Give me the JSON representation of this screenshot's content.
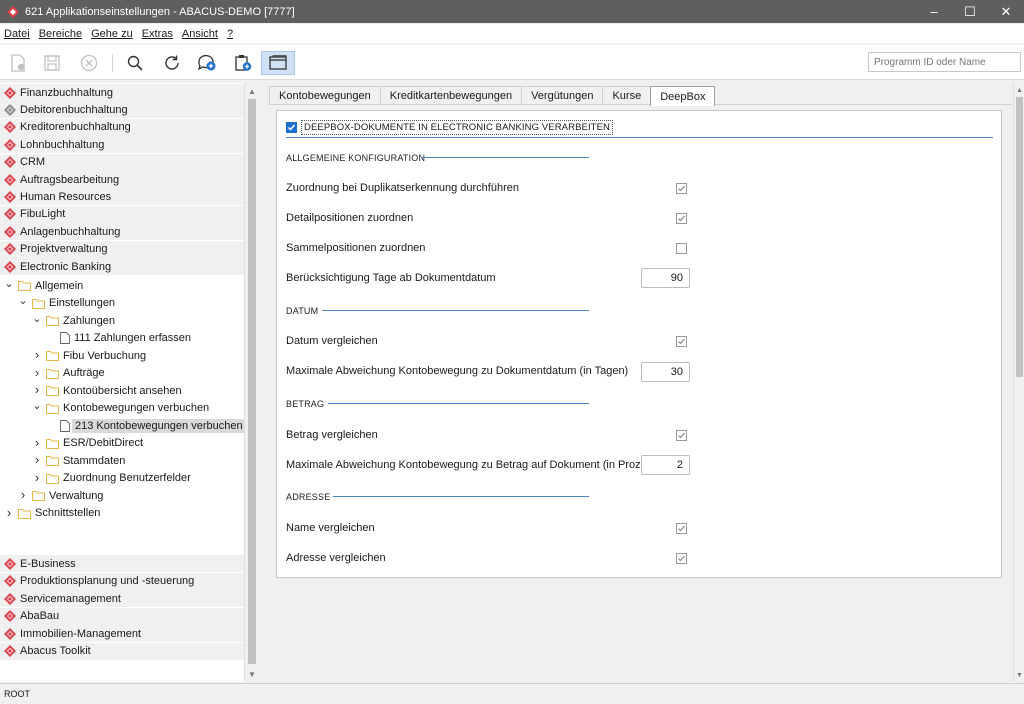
{
  "window": {
    "title": "621 Applikationseinstellungen - ABACUS-DEMO [7777]",
    "controls": [
      "–",
      "☐",
      "✕"
    ]
  },
  "menu": [
    {
      "label": "Datei"
    },
    {
      "label": "Bereiche"
    },
    {
      "label": "Gehe zu"
    },
    {
      "label": "Extras"
    },
    {
      "label": "Ansicht"
    },
    {
      "label": "?"
    }
  ],
  "toolbar": {
    "search_placeholder": "Programm ID oder Name"
  },
  "modules_top": [
    "Finanzbuchhaltung",
    "Debitorenbuchhaltung",
    "Kreditorenbuchhaltung",
    "Lohnbuchhaltung",
    "CRM",
    "Auftragsbearbeitung",
    "Human Resources",
    "FibuLight",
    "Anlagenbuchhaltung",
    "Projektverwaltung",
    "Electronic Banking"
  ],
  "tree": [
    {
      "label": "Allgemein",
      "level": 0,
      "expanded": true,
      "type": "folder"
    },
    {
      "label": "Einstellungen",
      "level": 1,
      "expanded": true,
      "type": "folder"
    },
    {
      "label": "Zahlungen",
      "level": 2,
      "expanded": true,
      "type": "folder"
    },
    {
      "label": "111 Zahlungen erfassen",
      "level": 3,
      "type": "doc"
    },
    {
      "label": "Fibu Verbuchung",
      "level": 2,
      "expanded": false,
      "type": "folder"
    },
    {
      "label": "Aufträge",
      "level": 2,
      "expanded": false,
      "type": "folder"
    },
    {
      "label": "Kontoübersicht ansehen",
      "level": 2,
      "expanded": false,
      "type": "folder"
    },
    {
      "label": "Kontobewegungen verbuchen",
      "level": 2,
      "expanded": true,
      "type": "folder"
    },
    {
      "label": "213 Kontobewegungen verbuchen",
      "level": 3,
      "type": "doc",
      "selected": true
    },
    {
      "label": "ESR/DebitDirect",
      "level": 2,
      "expanded": false,
      "type": "folder"
    },
    {
      "label": "Stammdaten",
      "level": 2,
      "expanded": false,
      "type": "folder"
    },
    {
      "label": "Zuordnung Benutzerfelder",
      "level": 2,
      "expanded": false,
      "type": "folder"
    },
    {
      "label": "Verwaltung",
      "level": 1,
      "expanded": false,
      "type": "folder"
    },
    {
      "label": "Schnittstellen",
      "level": 0,
      "expanded": false,
      "type": "folder"
    }
  ],
  "modules_bottom": [
    "E-Business",
    "Produktionsplanung und -steuerung",
    "Servicemanagement",
    "AbaBau",
    "Immobilien-Management",
    "Abacus Toolkit"
  ],
  "tabs": [
    {
      "label": "Kontobewegungen",
      "active": false
    },
    {
      "label": "Kreditkartenbewegungen",
      "active": false
    },
    {
      "label": "Vergütungen",
      "active": false
    },
    {
      "label": "Kurse",
      "active": false
    },
    {
      "label": "DeepBox",
      "active": true
    }
  ],
  "deepbox": {
    "main_checkbox_label": "DEEPBOX-DOKUMENTE IN ELECTRONIC BANKING VERARBEITEN",
    "main_checked": true,
    "sections": {
      "allgemein": "ALLGEMEINE KONFIGURATION",
      "datum": "DATUM",
      "betrag": "BETRAG",
      "adresse": "ADRESSE"
    },
    "rows": {
      "duplikat": {
        "label": "Zuordnung bei Duplikatserkennung durchführen",
        "checked": true
      },
      "detail": {
        "label": "Detailpositionen zuordnen",
        "checked": true
      },
      "sammel": {
        "label": "Sammelpositionen zuordnen",
        "checked": false
      },
      "tage": {
        "label": "Berücksichtigung Tage ab Dokumentdatum",
        "value": "90"
      },
      "datum_vergleichen": {
        "label": "Datum vergleichen",
        "checked": true
      },
      "max_datum": {
        "label": "Maximale Abweichung Kontobewegung zu Dokumentdatum (in Tagen)",
        "value": "30"
      },
      "betrag_vergleichen": {
        "label": "Betrag vergleichen",
        "checked": true
      },
      "max_betrag": {
        "label": "Maximale Abweichung Kontobewegung zu Betrag auf Dokument (in Prozent)",
        "value": "2"
      },
      "name": {
        "label": "Name vergleichen",
        "checked": true
      },
      "adresse": {
        "label": "Adresse vergleichen",
        "checked": true
      }
    }
  },
  "status": {
    "text": "ROOT"
  }
}
